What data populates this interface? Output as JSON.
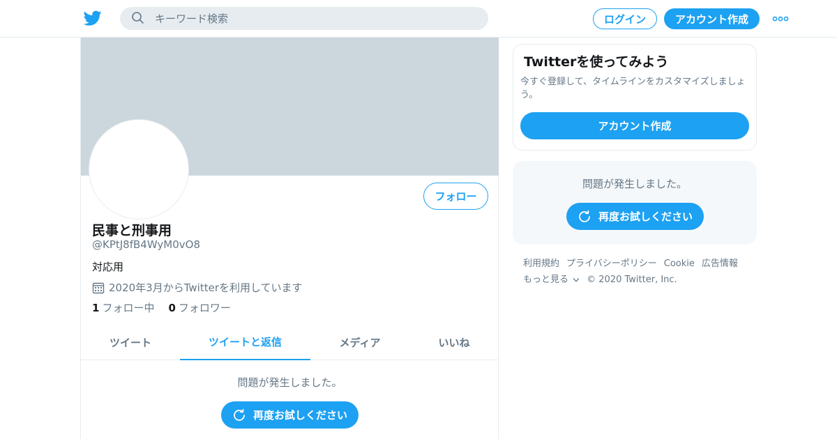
{
  "header": {
    "logo_icon": "twitter-bird-icon",
    "search_placeholder": "キーワード検索",
    "login_label": "ログイン",
    "signup_label": "アカウント作成",
    "more_icon": "more-dots-icon"
  },
  "profile": {
    "display_name": "民事と刑事用",
    "handle": "@KPtJ8fB4WyM0vO8",
    "bio": "対応用",
    "joined": "2020年3月からTwitterを利用しています",
    "following_count": "1",
    "following_label": "フォロー中",
    "followers_count": "0",
    "followers_label": "フォロワー",
    "follow_label": "フォロー"
  },
  "tabs": [
    {
      "label": "ツイート",
      "active": false
    },
    {
      "label": "ツイートと返信",
      "active": true
    },
    {
      "label": "メディア",
      "active": false
    },
    {
      "label": "いいね",
      "active": false
    }
  ],
  "main_error": {
    "message": "問題が発生しました。",
    "retry_label": "再度お試しください"
  },
  "sidebar": {
    "card_title": "Twitterを使ってみよう",
    "card_subtitle": "今すぐ登録して、タイムラインをカスタマイズしましょう。",
    "card_button": "アカウント作成",
    "error_message": "問題が発生しました。",
    "retry_label": "再度お試しください"
  },
  "footer": {
    "links": [
      "利用規約",
      "プライバシーポリシー",
      "Cookie",
      "広告情報"
    ],
    "more_label": "もっと見る",
    "copyright": "© 2020 Twitter, Inc."
  },
  "colors": {
    "accent": "#1da1f2",
    "banner": "#ccd6dd",
    "secondary_text": "#657786"
  }
}
